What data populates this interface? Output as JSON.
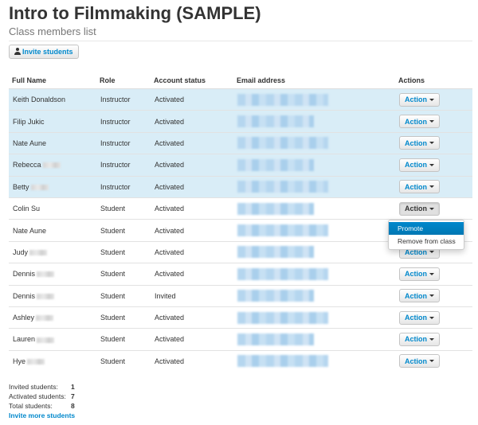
{
  "page": {
    "title": "Intro to Filmmaking (SAMPLE)",
    "subtitle": "Class members list",
    "invite_button": "Invite students"
  },
  "table": {
    "headers": [
      "Full Name",
      "Role",
      "Account status",
      "Email address",
      "Actions"
    ],
    "action_label": "Action",
    "rows": [
      {
        "name": "Keith Donaldson",
        "role": "Instructor",
        "status": "Activated",
        "highlighted": true
      },
      {
        "name": "Filip Jukic",
        "role": "Instructor",
        "status": "Activated",
        "highlighted": true
      },
      {
        "name": "Nate Aune",
        "role": "Instructor",
        "status": "Activated",
        "highlighted": true
      },
      {
        "name": "Rebecca",
        "role": "Instructor",
        "status": "Activated",
        "highlighted": true
      },
      {
        "name": "Betty",
        "role": "Instructor",
        "status": "Activated",
        "highlighted": true
      },
      {
        "name": "Colin Su",
        "role": "Student",
        "status": "Activated",
        "highlighted": false
      },
      {
        "name": "Nate Aune",
        "role": "Student",
        "status": "Activated",
        "highlighted": false
      },
      {
        "name": "Judy",
        "role": "Student",
        "status": "Activated",
        "highlighted": false
      },
      {
        "name": "Dennis",
        "role": "Student",
        "status": "Activated",
        "highlighted": false
      },
      {
        "name": "Dennis",
        "role": "Student",
        "status": "Invited",
        "highlighted": false
      },
      {
        "name": "Ashley",
        "role": "Student",
        "status": "Activated",
        "highlighted": false
      },
      {
        "name": "Lauren",
        "role": "Student",
        "status": "Activated",
        "highlighted": false
      },
      {
        "name": "Hye",
        "role": "Student",
        "status": "Activated",
        "highlighted": false
      }
    ]
  },
  "dropdown": {
    "items": [
      "Promote",
      "Remove from class"
    ]
  },
  "stats": {
    "invited_label": "Invited students:",
    "invited_value": "1",
    "activated_label": "Activated students:",
    "activated_value": "7",
    "total_label": "Total students:",
    "total_value": "8",
    "more_link": "Invite more students"
  },
  "colors": {
    "highlight_row": "#d9edf7",
    "link": "#0088cc",
    "dropdown_active": "#0088cc"
  }
}
